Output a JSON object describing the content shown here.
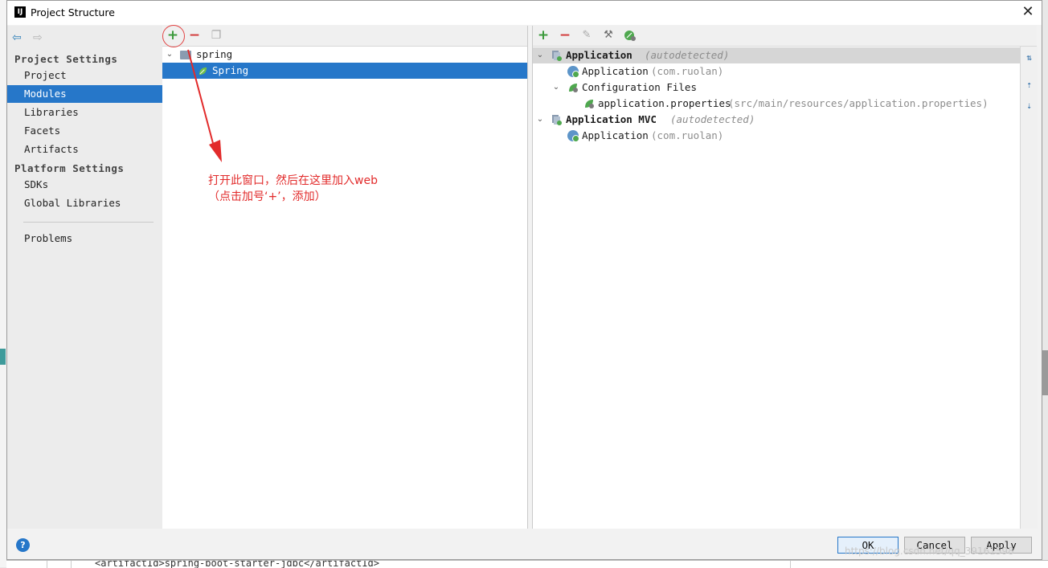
{
  "window": {
    "title": "Project Structure",
    "close_symbol": "✕"
  },
  "sidebar": {
    "sections": [
      {
        "header": "Project Settings",
        "items": [
          "Project",
          "Modules",
          "Libraries",
          "Facets",
          "Artifacts"
        ]
      },
      {
        "header": "Platform Settings",
        "items": [
          "SDKs",
          "Global Libraries"
        ]
      }
    ],
    "extra_item": "Problems",
    "selected": "Modules"
  },
  "modules_tree": {
    "root": "spring",
    "child": "Spring"
  },
  "annotation": {
    "line1": "打开此窗口，然后在这里加入web",
    "line2": "（点击加号‘+’，添加）",
    "color": "#e22b2b"
  },
  "spring_facets": {
    "rows": [
      {
        "label": "Application",
        "note": "(autodetected)"
      },
      {
        "label": "Application",
        "note": "(com.ruolan)"
      },
      {
        "label": "Configuration Files",
        "note": ""
      },
      {
        "label": "application.properties",
        "note": "(src/main/resources/application.properties)"
      },
      {
        "label": "Application MVC",
        "note": "(autodetected)"
      },
      {
        "label": "Application",
        "note": "(com.ruolan)"
      }
    ]
  },
  "buttons": {
    "ok": "OK",
    "cancel": "Cancel",
    "apply": "Apply",
    "help": "?"
  },
  "watermark": "https://blog.csdn.net/qq_39161598",
  "background_code": "<artifactId>spring-boot-starter-jdbc</artifactId>",
  "colors": {
    "selection": "#2677c9",
    "add": "#3c9a3c",
    "remove": "#d23a3a",
    "spring_green": "#4fa84f"
  }
}
